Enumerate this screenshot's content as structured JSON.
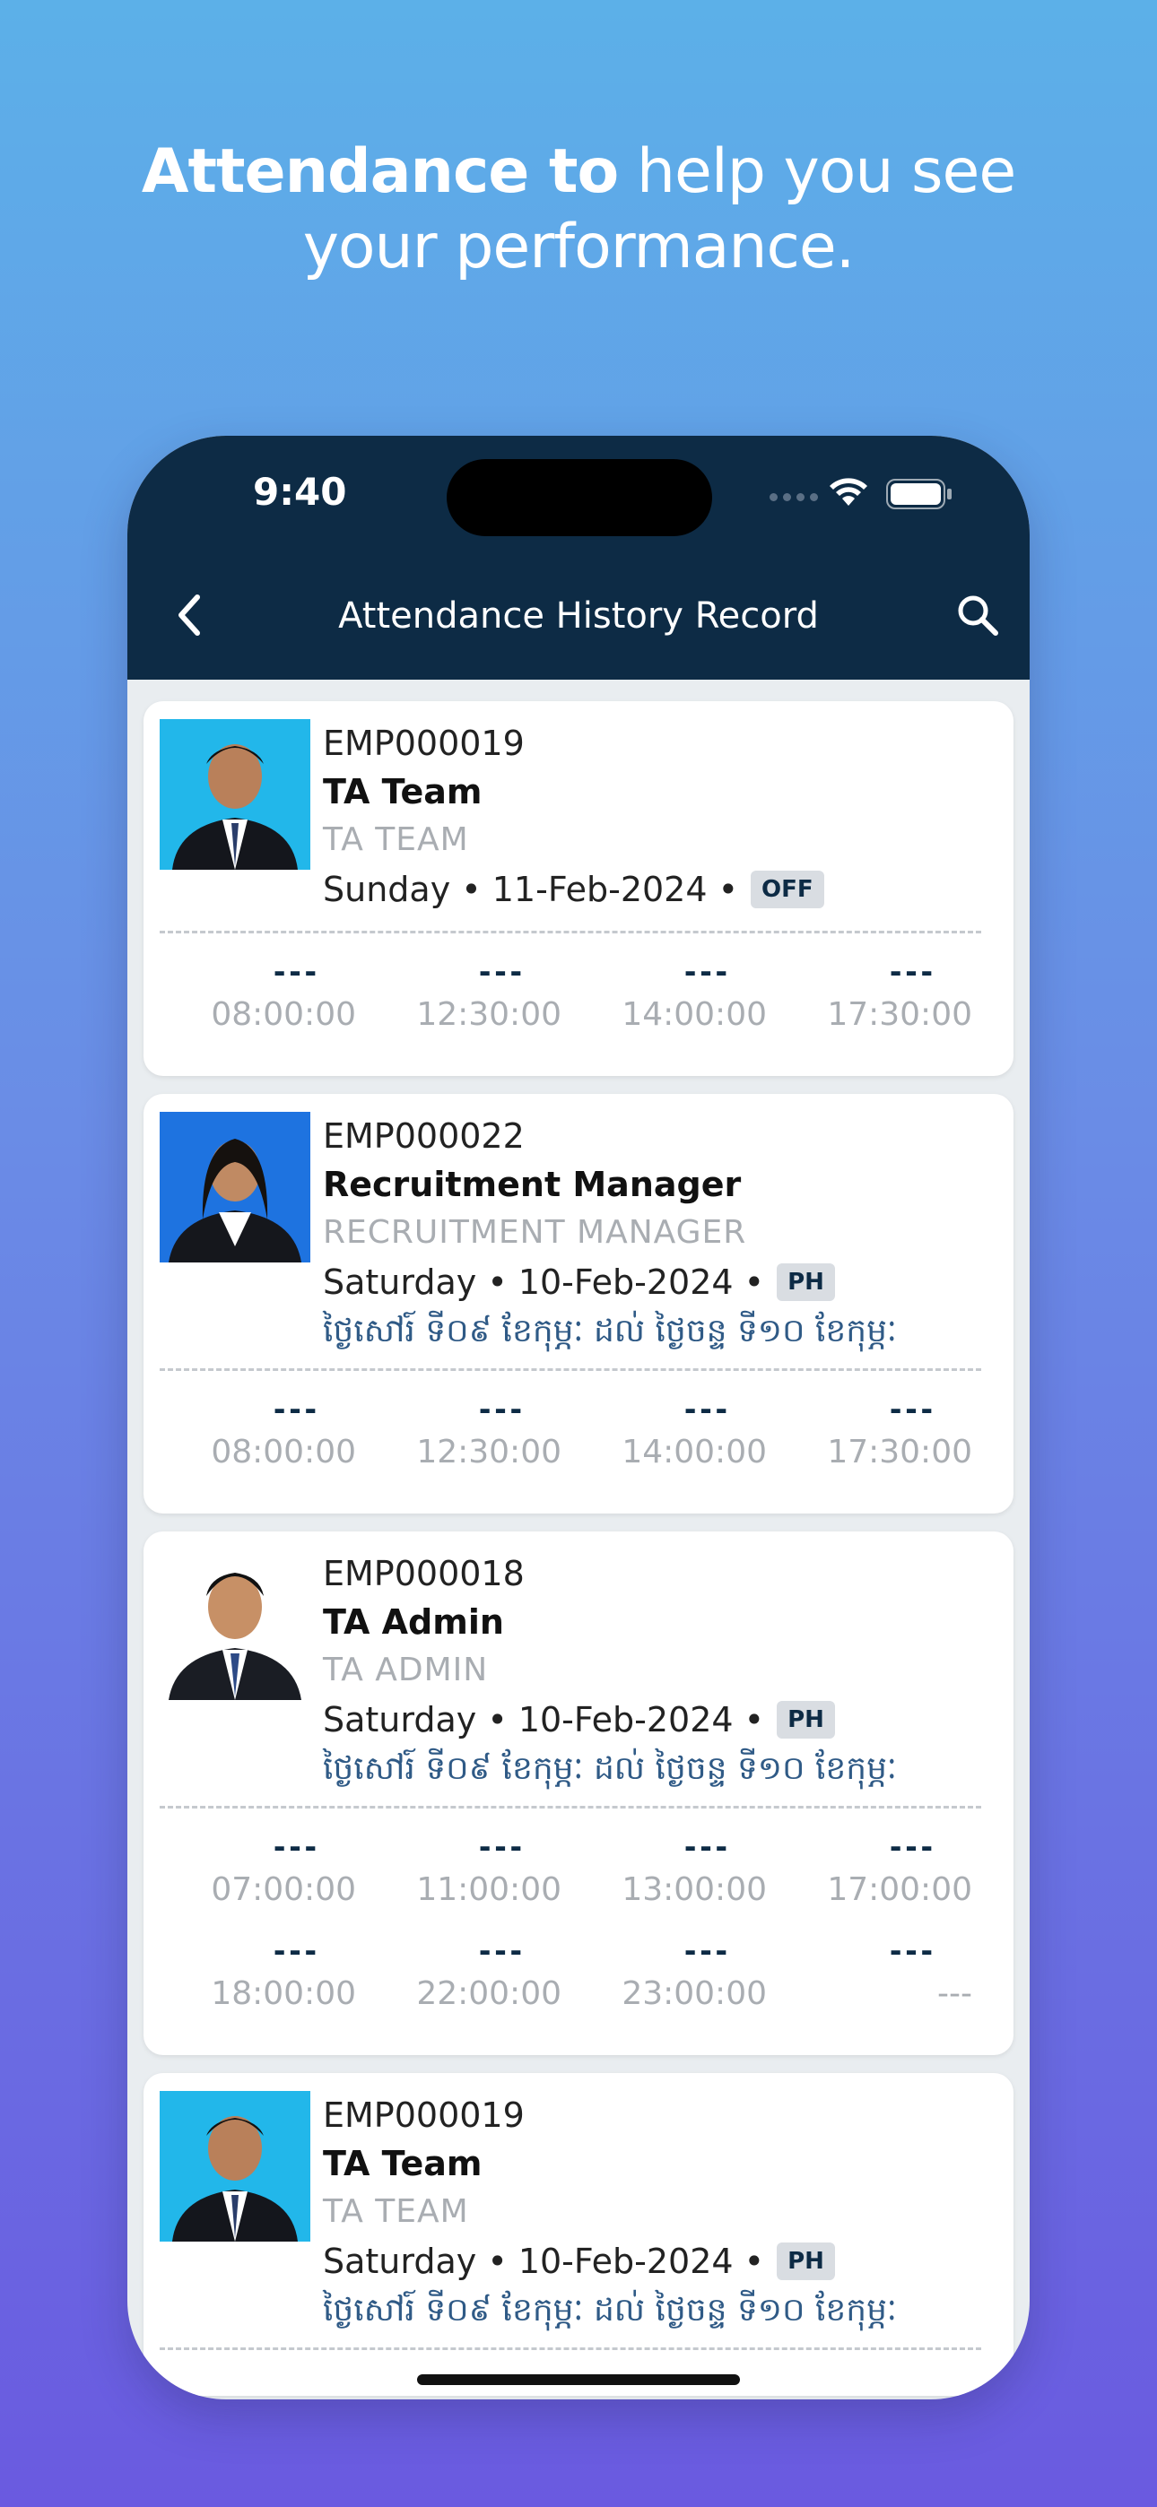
{
  "headline": {
    "bold": "Attendance to",
    "regular": " help you see",
    "line2": "your performance."
  },
  "status_bar": {
    "time": "9:40"
  },
  "appbar": {
    "title": "Attendance History Record"
  },
  "records": [
    {
      "id": "EMP000019",
      "name": "TA Team",
      "role": "TA TEAM",
      "date": "Sunday • 11-Feb-2024 •",
      "badge": "OFF",
      "khmer": "",
      "rows": [
        {
          "marks": [
            "---",
            "---",
            "---",
            "---"
          ],
          "times": [
            "08:00:00",
            "12:30:00",
            "14:00:00",
            "17:30:00"
          ]
        }
      ]
    },
    {
      "id": "EMP000022",
      "name": "Recruitment Manager",
      "role": "RECRUITMENT MANAGER",
      "date": "Saturday • 10-Feb-2024 •",
      "badge": "PH",
      "khmer": "ថ្ងៃសៅរ៍ ទី០៩ ខែកុម្ភៈ ដល់ ថ្ងៃចន្ទ ទី១០ ខែកុម្ភៈ",
      "rows": [
        {
          "marks": [
            "---",
            "---",
            "---",
            "---"
          ],
          "times": [
            "08:00:00",
            "12:30:00",
            "14:00:00",
            "17:30:00"
          ]
        }
      ]
    },
    {
      "id": "EMP000018",
      "name": "TA Admin",
      "role": "TA ADMIN",
      "date": "Saturday • 10-Feb-2024 •",
      "badge": "PH",
      "khmer": "ថ្ងៃសៅរ៍ ទី០៩ ខែកុម្ភៈ ដល់ ថ្ងៃចន្ទ ទី១០ ខែកុម្ភៈ",
      "rows": [
        {
          "marks": [
            "---",
            "---",
            "---",
            "---"
          ],
          "times": [
            "07:00:00",
            "11:00:00",
            "13:00:00",
            "17:00:00"
          ]
        },
        {
          "marks": [
            "---",
            "---",
            "---",
            "---"
          ],
          "times": [
            "18:00:00",
            "22:00:00",
            "23:00:00",
            "---"
          ]
        }
      ]
    },
    {
      "id": "EMP000019",
      "name": "TA Team",
      "role": "TA TEAM",
      "date": "Saturday • 10-Feb-2024 •",
      "badge": "PH",
      "khmer": "ថ្ងៃសៅរ៍ ទី០៩ ខែកុម្ភៈ ដល់ ថ្ងៃចន្ទ ទី១០ ខែកុម្ភៈ",
      "rows": []
    }
  ],
  "colors": {
    "appbar": "#0d2b45",
    "khmer_text": "#2f5a86",
    "muted": "#a9adb2",
    "badge_bg": "#d9dde2"
  }
}
